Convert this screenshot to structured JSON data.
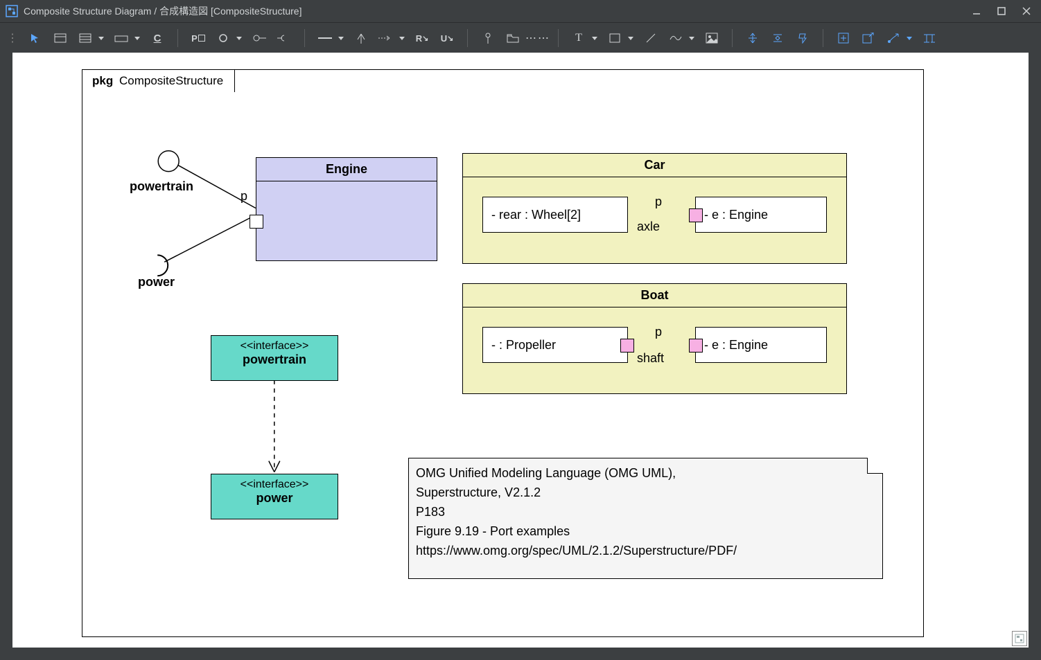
{
  "title": "Composite Structure Diagram / 合成構造図 [CompositeStructure]",
  "diagram": {
    "tab_prefix": "pkg",
    "tab_name": "CompositeStructure"
  },
  "engine": {
    "name": "Engine",
    "portLabel": "p"
  },
  "ball": {
    "label": "powertrain"
  },
  "socket": {
    "label": "power"
  },
  "car": {
    "name": "Car",
    "rear": "- rear : Wheel[2]",
    "e": "- e : Engine",
    "connLabel": "axle",
    "portLabel": "p"
  },
  "boat": {
    "name": "Boat",
    "prop": "-  : Propeller",
    "e": "- e : Engine",
    "connLabel": "shaft",
    "portLabel": "p"
  },
  "iface1": {
    "stereo": "<<interface>>",
    "name": "powertrain"
  },
  "iface2": {
    "stereo": "<<interface>>",
    "name": "power"
  },
  "note": {
    "l1": "OMG Unified Modeling Language (OMG UML),",
    "l2": "Superstructure, V2.1.2",
    "l3": "P183",
    "l4": "Figure 9.19 - Port examples",
    "l5": "https://www.omg.org/spec/UML/2.1.2/Superstructure/PDF/"
  },
  "toolbar": {
    "icons": [
      "pointer",
      "hsplit",
      "vsplit",
      "dd",
      "rect",
      "dd",
      "c-underline",
      "p-box",
      "circle",
      "dd",
      "lollipop",
      "socket",
      "line",
      "dd",
      "arrow-up",
      "dots-arrow",
      "dd",
      "r-down",
      "u-down",
      "pin",
      "folder",
      "dots",
      "t",
      "dd",
      "square",
      "dd",
      "slash",
      "wave",
      "dd",
      "image",
      "vgap-in",
      "vgap-out",
      "pin2",
      "boxplus",
      "boxarrow",
      "zarrow",
      "dd",
      "tree"
    ]
  }
}
